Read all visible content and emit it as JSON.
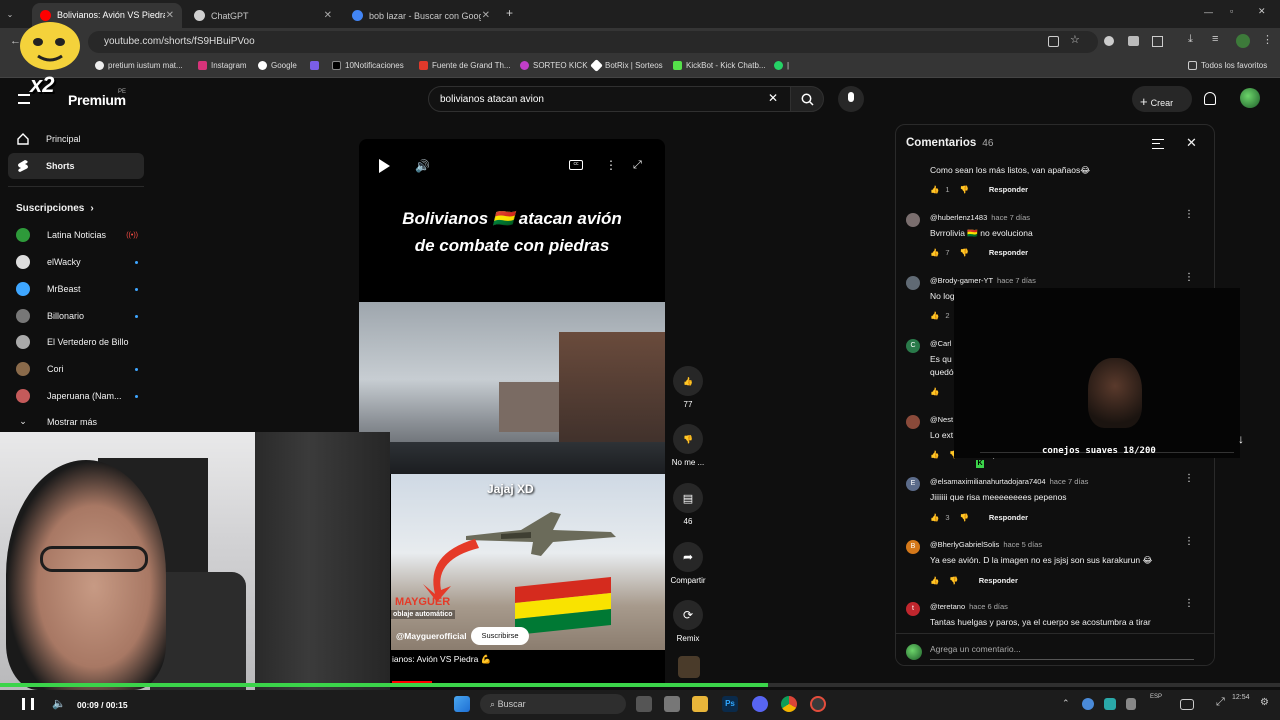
{
  "browser": {
    "tabs": [
      {
        "title": "Bolivianos: Avión VS Piedra 💪",
        "active": true
      },
      {
        "title": "ChatGPT",
        "active": false
      },
      {
        "title": "bob lazar - Buscar con Google",
        "active": false
      }
    ],
    "url": "youtube.com/shorts/fS9HBuiPVoo",
    "bookmarks": [
      "pretium iustum mat...",
      "Instagram",
      "Google",
      "10Notificaciones",
      "Fuente de Grand Th...",
      "SORTEO KICK",
      "BotRix | Sorteos",
      "KickBot - Kick Chatb..."
    ],
    "all_bookmarks": "Todos los favoritos"
  },
  "header": {
    "logo": "Premium",
    "logo_region": "PE",
    "search_query": "bolivianos atacan avion",
    "create_label": "Crear"
  },
  "sidebar": {
    "items": [
      {
        "label": "Principal",
        "icon": "home-icon"
      },
      {
        "label": "Shorts",
        "icon": "shorts-icon"
      }
    ],
    "subscriptions_heading": "Suscripciones",
    "channels": [
      {
        "name": "Latina Noticias",
        "live": true
      },
      {
        "name": "elWacky"
      },
      {
        "name": "MrBeast"
      },
      {
        "name": "Billonario"
      },
      {
        "name": "El Vertedero de Billo"
      },
      {
        "name": "Cori"
      },
      {
        "name": "Japeruana (Nam..."
      }
    ],
    "show_more": "Mostrar más"
  },
  "short": {
    "title_line1": "Bolivianos 🇧🇴 atacan avión",
    "title_line2": "de combate con piedras",
    "overlay_text": "Jajaj XD",
    "watermark": "MAYGUER",
    "dub_label": "oblaje automático",
    "channel": "@Mayguerofficial",
    "subscribe": "Suscribirse",
    "caption": "ianos: Avión VS Piedra 💪",
    "likes": "77",
    "dislike_label": "No me ...",
    "comments_count": "46",
    "share_label": "Compartir",
    "remix_label": "Remix"
  },
  "comments_panel": {
    "title": "Comentarios",
    "count": "46",
    "reply_label": "Responder",
    "add_placeholder": "Agrega un comentario...",
    "items": [
      {
        "author": "",
        "time": "",
        "text": "Como sean los más listos, van apañaos😂",
        "likes": "1"
      },
      {
        "author": "@huberlenz1483",
        "time": "hace 7 días",
        "text": "Bvrrolivia 🇧🇴 no evoluciona",
        "likes": "7"
      },
      {
        "author": "@Brody-gamer-YT",
        "time": "hace 7 días",
        "text": "No log",
        "likes": "2"
      },
      {
        "author": "@Carl",
        "time": "",
        "text": "Es qu",
        "text2": "quedó",
        "likes": ""
      },
      {
        "author": "@Nest",
        "time": "",
        "text": "Lo ext",
        "likes": ""
      },
      {
        "author": "@elsamaximilianahurtadojara7404",
        "time": "hace 7 días",
        "text": "Jiiiiiii que risa meeeeeeees pepenos",
        "likes": "3"
      },
      {
        "author": "@BherlyGabrielSolis",
        "time": "hace 5 días",
        "text": "Ya ese avión. D la imagen no es jsjsj son sus karakurun 😂",
        "likes": ""
      },
      {
        "author": "@teretano",
        "time": "hace 6 días",
        "text": "Tantas huelgas y paros, ya el cuerpo se acostumbra a tirar",
        "likes": ""
      }
    ]
  },
  "stream_overlay": {
    "reward_text": "conejos suaves 18/200",
    "multiplier": "x2"
  },
  "playback": {
    "current": "00:09",
    "duration": "00:15",
    "progress": 0.6
  },
  "taskbar": {
    "search_label": "Buscar",
    "lang": "ESP",
    "time": "12:54"
  },
  "colors": {
    "accent_green": "#3bd44a",
    "youtube_bg": "#0f0f0f",
    "link_blue": "#3ea6ff"
  }
}
